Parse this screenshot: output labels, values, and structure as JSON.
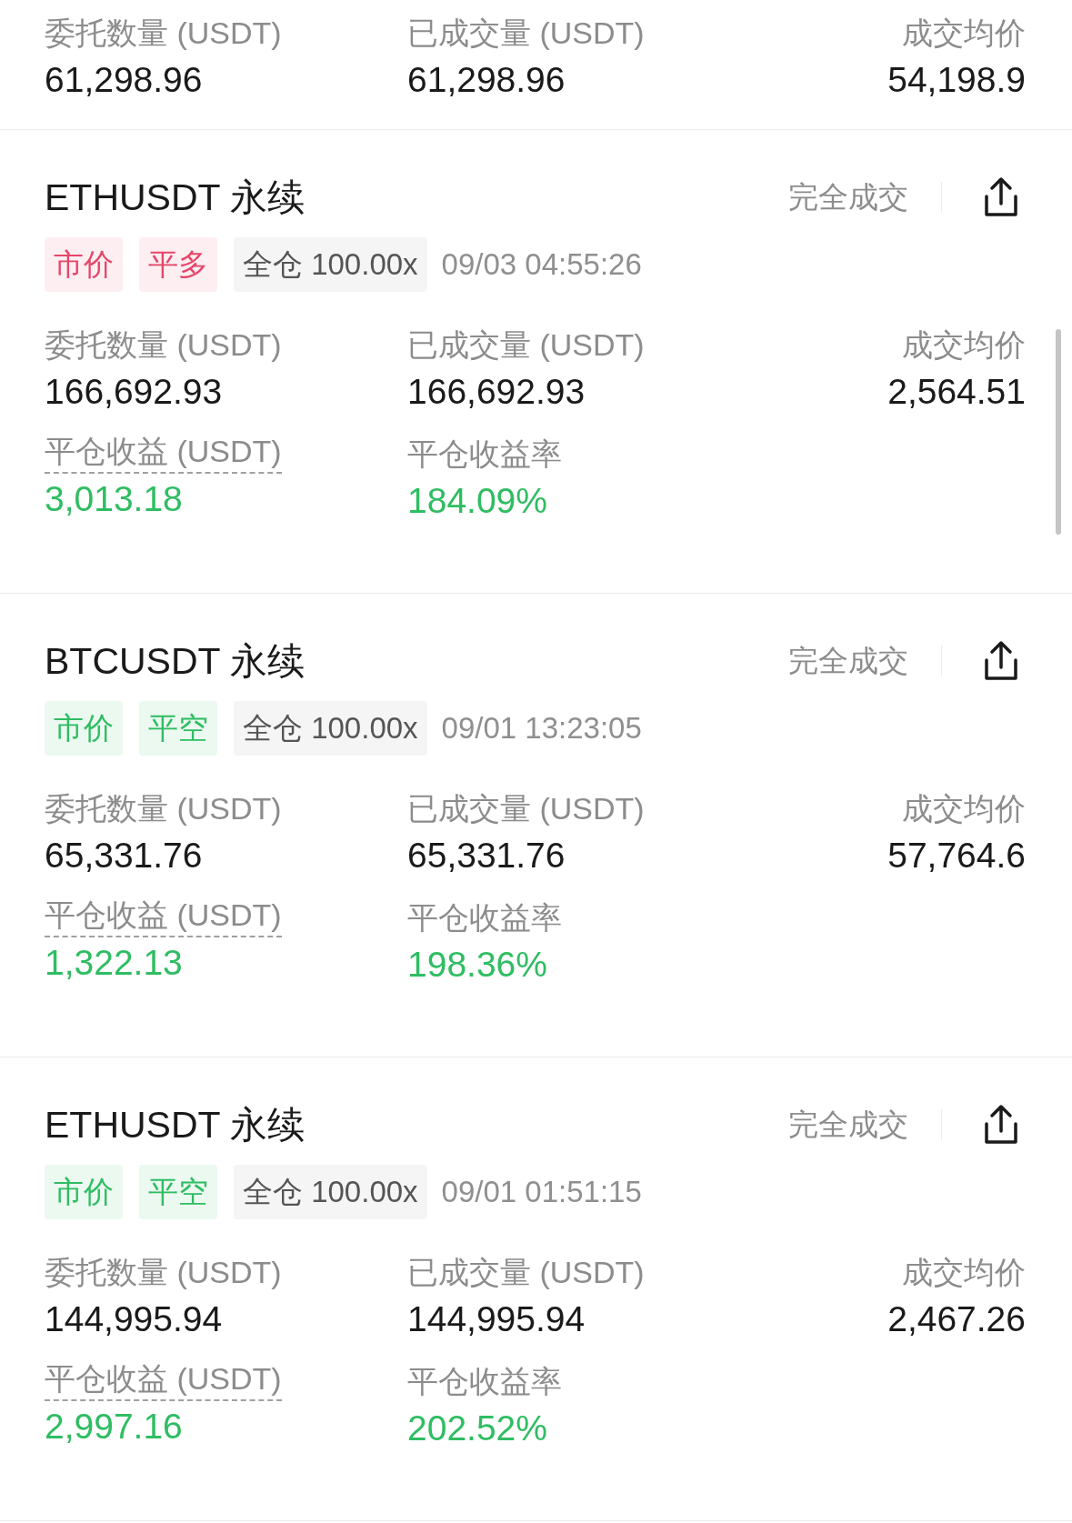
{
  "top_order": {
    "stats": [
      {
        "label": "委托数量 (USDT)",
        "value": "61,298.96"
      },
      {
        "label": "已成交量 (USDT)",
        "value": "61,298.96"
      },
      {
        "label": "成交均价",
        "value": "54,198.9"
      }
    ]
  },
  "orders": [
    {
      "symbol": "ETHUSDT 永续",
      "status": "完全成交",
      "tags": [
        {
          "label": "市价",
          "color": "#e5476a"
        },
        {
          "label": "平多",
          "color": "#e5476a"
        }
      ],
      "margin": "全仓 100.00x",
      "time": "09/03 04:55:26",
      "stats": [
        {
          "label": "委托数量 (USDT)",
          "value": "166,692.93"
        },
        {
          "label": "已成交量 (USDT)",
          "value": "166,692.93"
        },
        {
          "label": "成交均价",
          "value": "2,564.51"
        }
      ],
      "pnl": {
        "label": "平仓收益 (USDT)",
        "value": "3,013.18"
      },
      "pnl_rate": {
        "label": "平仓收益率",
        "value": "184.09%"
      }
    },
    {
      "symbol": "BTCUSDT 永续",
      "status": "完全成交",
      "tags": [
        {
          "label": "市价",
          "color": "#2fbd62"
        },
        {
          "label": "平空",
          "color": "#2fbd62"
        }
      ],
      "margin": "全仓 100.00x",
      "time": "09/01 13:23:05",
      "stats": [
        {
          "label": "委托数量 (USDT)",
          "value": "65,331.76"
        },
        {
          "label": "已成交量 (USDT)",
          "value": "65,331.76"
        },
        {
          "label": "成交均价",
          "value": "57,764.6"
        }
      ],
      "pnl": {
        "label": "平仓收益 (USDT)",
        "value": "1,322.13"
      },
      "pnl_rate": {
        "label": "平仓收益率",
        "value": "198.36%"
      }
    },
    {
      "symbol": "ETHUSDT 永续",
      "status": "完全成交",
      "tags": [
        {
          "label": "市价",
          "color": "#2fbd62"
        },
        {
          "label": "平空",
          "color": "#2fbd62"
        }
      ],
      "margin": "全仓 100.00x",
      "time": "09/01 01:51:15",
      "stats": [
        {
          "label": "委托数量 (USDT)",
          "value": "144,995.94"
        },
        {
          "label": "已成交量 (USDT)",
          "value": "144,995.94"
        },
        {
          "label": "成交均价",
          "value": "2,467.26"
        }
      ],
      "pnl": {
        "label": "平仓收益 (USDT)",
        "value": "2,997.16"
      },
      "pnl_rate": {
        "label": "平仓收益率",
        "value": "202.52%"
      }
    }
  ]
}
